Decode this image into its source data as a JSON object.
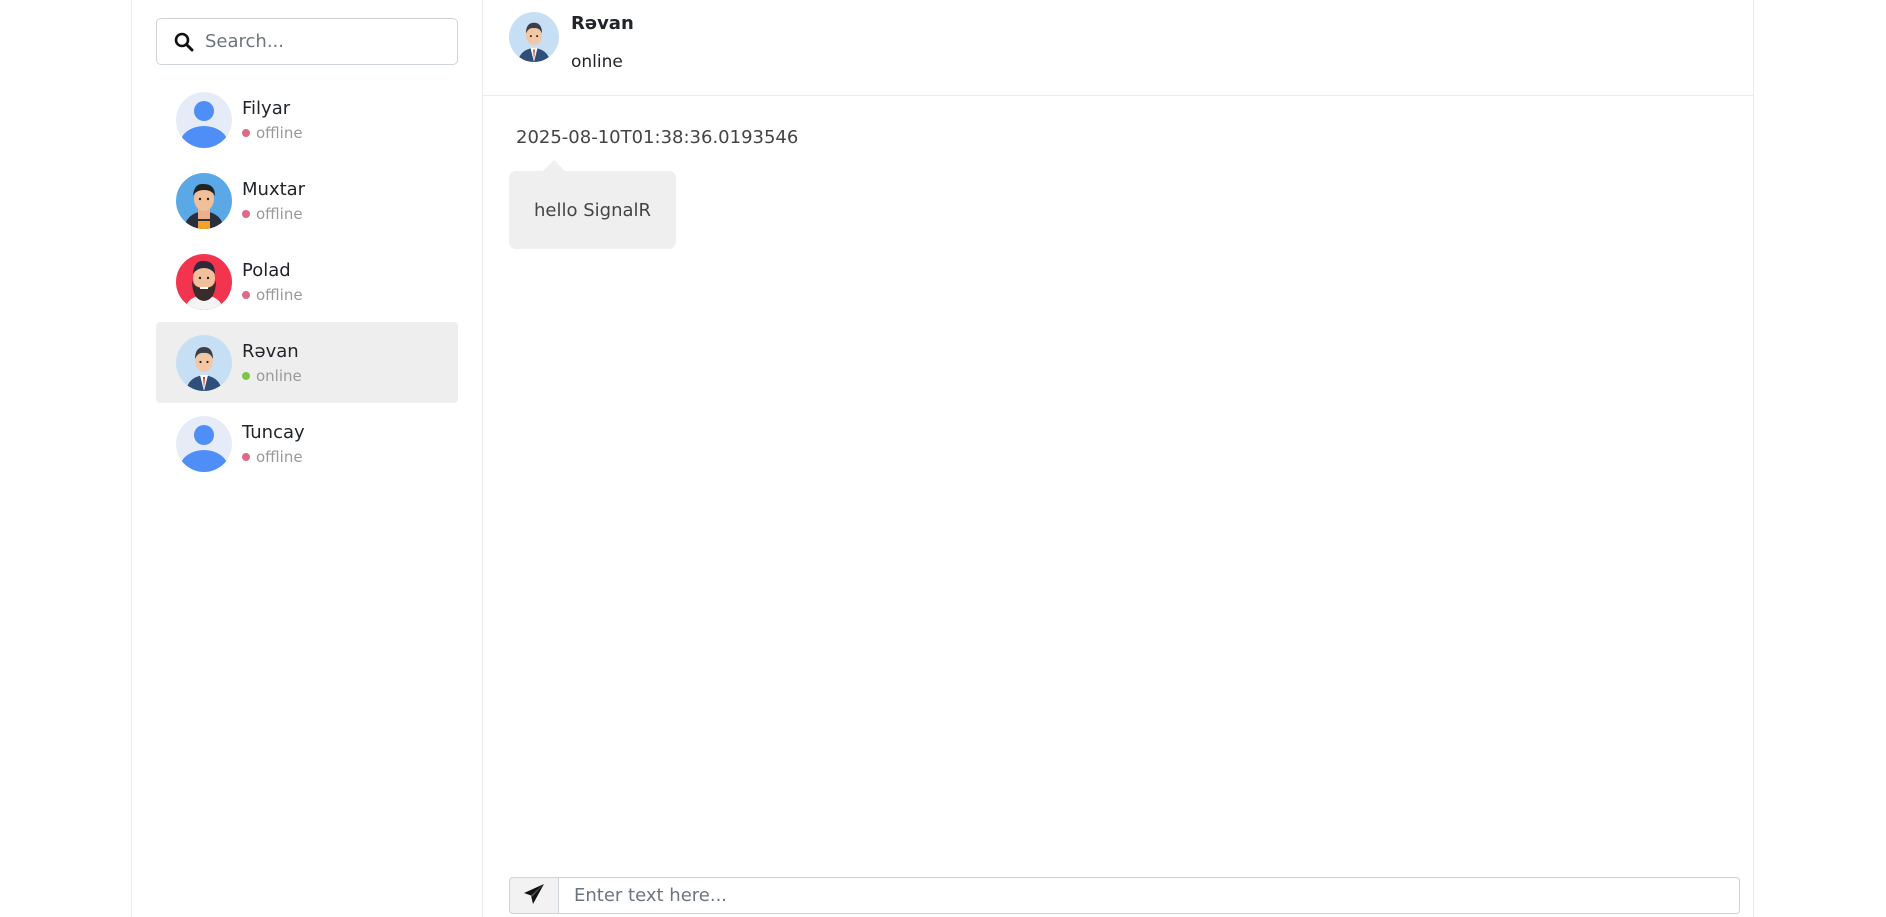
{
  "search": {
    "placeholder": "Search...",
    "icon": "search-icon"
  },
  "contacts": [
    {
      "name": "Filyar",
      "status": "offline",
      "avatar": "default-user-avatar"
    },
    {
      "name": "Muxtar",
      "status": "offline",
      "avatar": "man-avatar"
    },
    {
      "name": "Polad",
      "status": "offline",
      "avatar": "bearded-man-avatar"
    },
    {
      "name": "Rəvan",
      "status": "online",
      "avatar": "businessman-avatar",
      "selected": true
    },
    {
      "name": "Tuncay",
      "status": "offline",
      "avatar": "default-user-avatar"
    }
  ],
  "colors": {
    "online": "#7ac943",
    "offline": "#de6a86",
    "active_row": "#eeeeee",
    "bubble": "#efefef"
  },
  "chat": {
    "header": {
      "name": "Rəvan",
      "status": "online"
    },
    "messages": [
      {
        "time": "2025-08-10T01:38:36.0193546",
        "text": "hello SignalR"
      }
    ],
    "composer": {
      "placeholder": "Enter text here...",
      "send_icon": "paper-plane-icon"
    }
  }
}
